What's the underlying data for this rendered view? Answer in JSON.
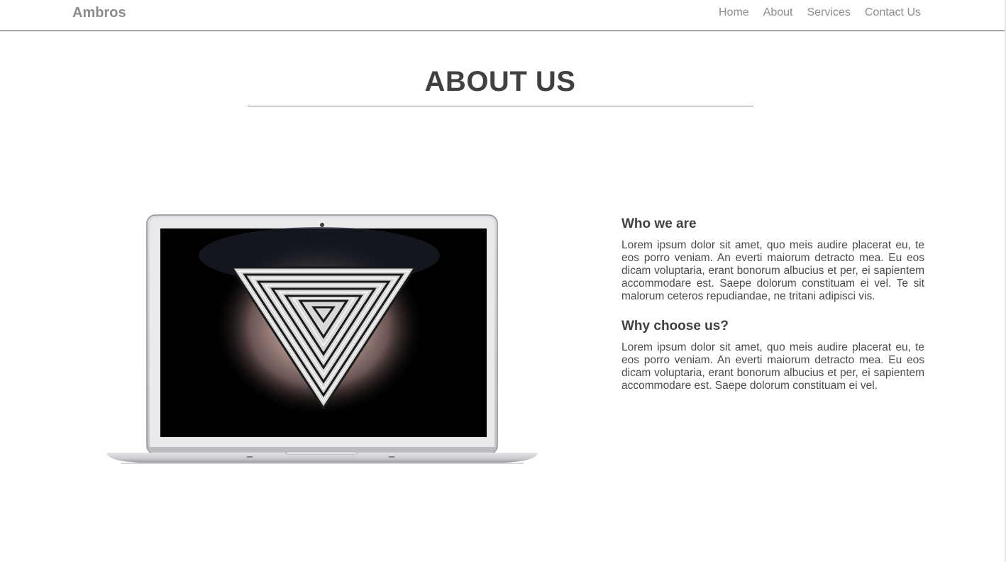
{
  "navbar": {
    "brand": "Ambros",
    "links": [
      {
        "label": "Home"
      },
      {
        "label": "About"
      },
      {
        "label": "Services"
      },
      {
        "label": "Contact Us"
      }
    ]
  },
  "about": {
    "title": "ABOUT US",
    "image_icon": "laptop-with-triangle-logo-icon",
    "blocks": [
      {
        "heading": "Who we are",
        "text": "Lorem ipsum dolor sit amet, quo meis audire placerat eu, te eos porro veniam. An everti maiorum detracto mea. Eu eos dicam voluptaria, erant bonorum albucius et per, ei sapientem accommodare est. Saepe dolorum constituam ei vel. Te sit malorum ceteros repudiandae, ne tritani adipisci vis."
      },
      {
        "heading": "Why choose us?",
        "text": "Lorem ipsum dolor sit amet, quo meis audire placerat eu, te eos porro veniam. An everti maiorum detracto mea. Eu eos dicam voluptaria, erant bonorum albucius et per, ei sapientem accommodare est. Saepe dolorum constituam ei vel."
      }
    ]
  },
  "colors": {
    "text_dark": "#404040",
    "nav_text": "#8c8c8c",
    "rule": "#8a8a8a",
    "background": "#ffffff"
  }
}
